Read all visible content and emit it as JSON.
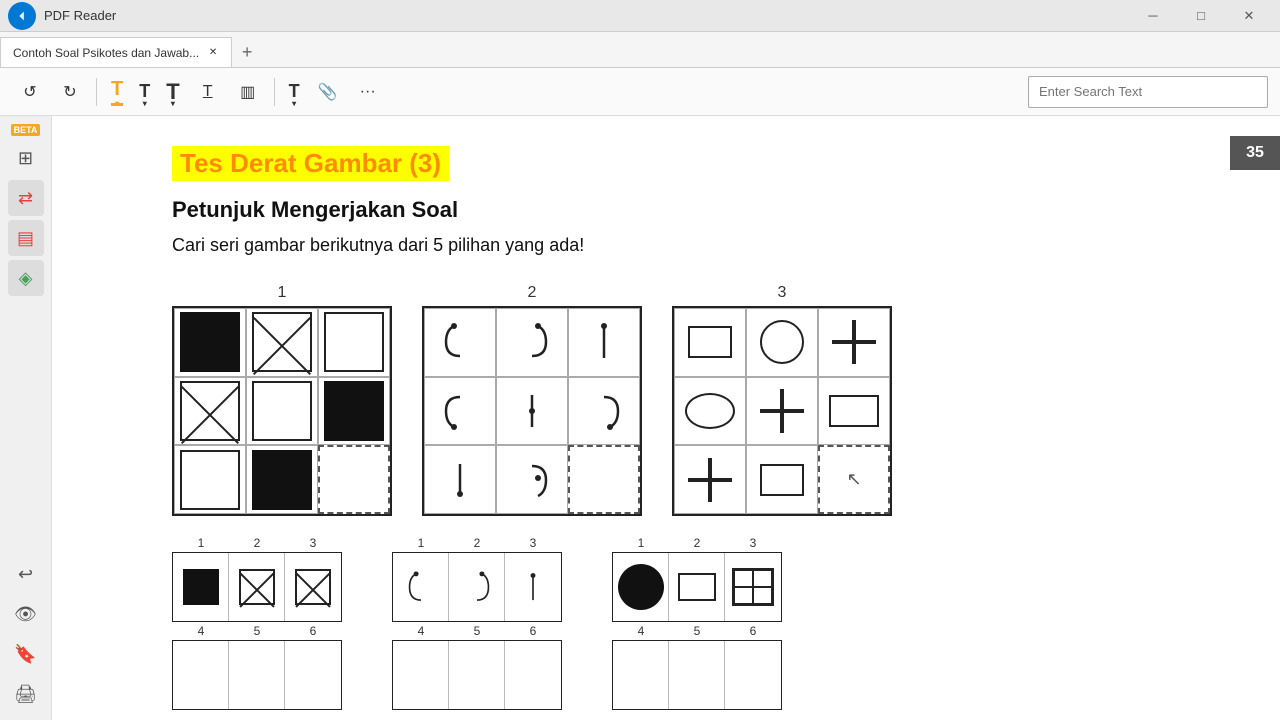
{
  "titlebar": {
    "back_btn": "←",
    "title": "PDF Reader",
    "minimize": "─",
    "maximize": "□",
    "close": "✕"
  },
  "tabs": [
    {
      "label": "Contoh Soal Psikotes dan Jawab...",
      "active": true
    }
  ],
  "tab_new": "+",
  "toolbar": {
    "undo": "↺",
    "redo": "↻",
    "highlight": "T",
    "text_t1": "T",
    "text_t2": "T",
    "underline": "T͟",
    "stamp": "▥",
    "edit_text": "T",
    "attach": "📎",
    "more": "···",
    "search_placeholder": "Enter Search Text"
  },
  "sidebar": {
    "beta_label": "BETA",
    "icons": [
      {
        "name": "grid-icon",
        "symbol": "⊞"
      },
      {
        "name": "arrows-icon",
        "symbol": "⇄"
      },
      {
        "name": "stack-icon",
        "symbol": "▤"
      },
      {
        "name": "layers-icon",
        "symbol": "◈"
      },
      {
        "name": "send-icon",
        "symbol": "↩"
      },
      {
        "name": "eye-icon",
        "symbol": "👁"
      },
      {
        "name": "bookmark-icon",
        "symbol": "🔖"
      },
      {
        "name": "print-icon",
        "symbol": "🖨"
      }
    ]
  },
  "page": {
    "number": "35",
    "content": {
      "title": "Tes Derat Gambar (3)",
      "subtitle": "Petunjuk Mengerjakan Soal",
      "instruction": "Cari seri gambar berikutnya dari 5 pilihan yang ada!"
    }
  },
  "grids": [
    {
      "number": "1"
    },
    {
      "number": "2"
    },
    {
      "number": "3"
    }
  ]
}
